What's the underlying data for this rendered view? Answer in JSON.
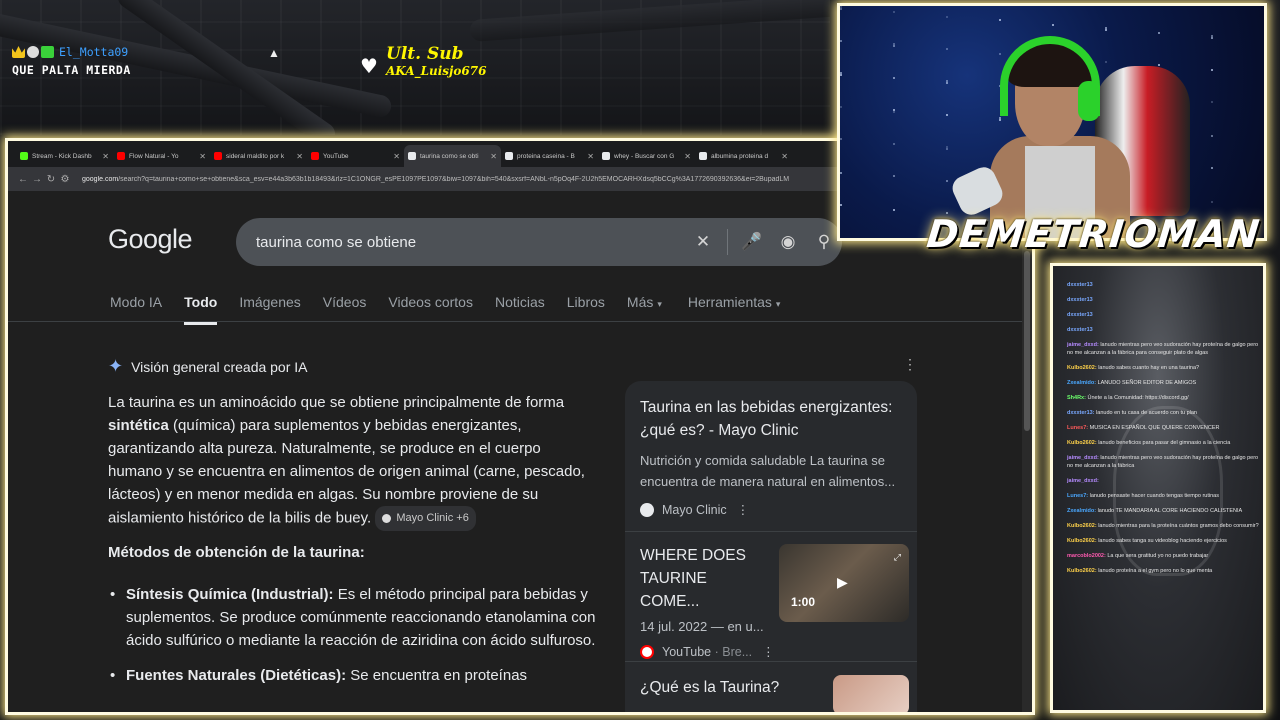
{
  "overlay": {
    "chat_user": "El_Motta09",
    "chat_msg": "QUE PALTA MIERDA",
    "ult_sub_label": "Ult. Sub",
    "ult_sub_name": "AKA_Luisjo676",
    "streamer_name": "DEMETRIOMAN"
  },
  "browser": {
    "tabs": [
      {
        "title": "Stream - Kick Dashb",
        "color": "#53fc18",
        "active": false
      },
      {
        "title": "Flow Natural - Yo",
        "color": "#ff0000",
        "active": false
      },
      {
        "title": "sideral maldito por k",
        "color": "#ff0000",
        "active": false
      },
      {
        "title": "YouTube",
        "color": "#ff0000",
        "active": false
      },
      {
        "title": "taurina como se obti",
        "color": "#e8eaed",
        "active": true
      },
      {
        "title": "proteina caseina - B",
        "color": "#e8eaed",
        "active": false
      },
      {
        "title": "whey - Buscar con G",
        "color": "#e8eaed",
        "active": false
      },
      {
        "title": "albumina proteina d",
        "color": "#e8eaed",
        "active": false
      }
    ],
    "url_host": "google.com",
    "url_rest": "/search?q=taurina+como+se+obtiene&sca_esv=e44a3b63b1b18493&rlz=1C1ONGR_esPE1097PE1097&biw=1097&bih=540&sxsrf=ANbL-n5pOq4F-2U2h5EMOCARHXdsq5bCCg%3A1772690392636&ei=2BupadLM"
  },
  "google": {
    "logo": "Google",
    "query": "taurina como se obtiene",
    "tabs": [
      "Modo IA",
      "Todo",
      "Imágenes",
      "Vídeos",
      "Videos cortos",
      "Noticias",
      "Libros",
      "Más",
      "Herramientas"
    ],
    "active_tab": "Todo"
  },
  "aio": {
    "header": "Visión general creada por IA",
    "p1_a": "La taurina es un aminoácido que se obtiene principalmente de forma ",
    "p1_b": "sintética",
    "p1_c": " (química) para suplementos y bebidas energizantes, garantizando alta pureza. Naturalmente, se produce en el cuerpo humano y se encuentra en alimentos de origen animal (carne, pescado, lácteos) y en menor medida en algas. Su nombre proviene de su aislamiento histórico de la bilis de buey.",
    "chip": "Mayo Clinic +6",
    "heading": "Métodos de obtención de la taurina:",
    "b1_bold": "Síntesis Química (Industrial):",
    "b1_text": " Es el método principal para bebidas y suplementos. Se produce comúnmente reaccionando etanolamina con ácido sulfúrico o mediante la reacción de aziridina con ácido sulfuroso.",
    "b2_bold": "Fuentes Naturales (Dietéticas):",
    "b2_text": " Se encuentra en proteínas"
  },
  "sources": {
    "s1_title": "Taurina en las bebidas energizantes: ¿qué es? - Mayo Clinic",
    "s1_desc": "Nutrición y comida saludable La taurina se encuentra de manera natural en alimentos...",
    "s1_site": "Mayo Clinic",
    "s2_title": "WHERE DOES TAURINE COME...",
    "s2_date": "14 jul. 2022 — en u...",
    "s2_site": "YouTube",
    "s2_channel": "· Bre...",
    "s2_dur": "1:00",
    "s3_title": "¿Qué es la Taurina?"
  },
  "chat": {
    "lines": [
      {
        "u": "dxxxter13",
        "m": "",
        "c": "#79a8ff"
      },
      {
        "u": "dxxxter13",
        "m": "",
        "c": "#79a8ff"
      },
      {
        "u": "dxxxter13",
        "m": "",
        "c": "#79a8ff"
      },
      {
        "u": "dxxxter13",
        "m": "",
        "c": "#79a8ff"
      },
      {
        "u": "jaime_dxxd:",
        "m": "lanudo mientras pero veo sudoración hay proteína de galgo pero no me alcanzan a la fábrica para conseguir plato de algas",
        "c": "#b58bff"
      },
      {
        "u": "Kulbo2602:",
        "m": "lanudo sabes cuanto hay en una taurina?",
        "c": "#ffd24a"
      },
      {
        "u": "Zxealmido:",
        "m": "LANUDO SEÑOR EDITOR DE AMIGOS",
        "c": "#4aa8ff"
      },
      {
        "u": "Sh4Rx:",
        "m": "Únete a la Comunidad: https://discord.gg/",
        "c": "#6bff6b"
      },
      {
        "u": "dxxxter13:",
        "m": "lanudo en tu casa de acuerdo con tu plan",
        "c": "#79a8ff"
      },
      {
        "u": "Lunes7:",
        "m": "MUSICA EN ESPAÑOL QUE QUIERE CONVENCER",
        "c": "#ff5a5a"
      },
      {
        "u": "Kulbo2602:",
        "m": "lanudo beneficios para pasar del gimnasio a la ciencia",
        "c": "#ffd24a"
      },
      {
        "u": "jaime_dxxd:",
        "m": "lanudo mientras pero veo sudoración hay proteína de galgo pero no me alcanzan a la fábrica",
        "c": "#b58bff"
      },
      {
        "u": "jaime_dxxd:",
        "m": "",
        "c": "#b58bff"
      },
      {
        "u": "Lunes7:",
        "m": "lanudo pensaste hacer cuando tengas tiempo rutinas",
        "c": "#4aa8ff"
      },
      {
        "u": "Zxealmido:",
        "m": "lanudo TE MANDARIA AL CORE HACIENDO CALISTENIA",
        "c": "#4aa8ff"
      },
      {
        "u": "Kulbo2602:",
        "m": "lanudo mientras para la proteína cuántos gramos debo consumir?",
        "c": "#ffd24a"
      },
      {
        "u": "Kulbo2602:",
        "m": "lanudo sabes tanga su videoblog haciendo ejercicios",
        "c": "#ffd24a"
      },
      {
        "u": "marcoblo2002:",
        "m": "La que sera gratitud yo no puedo trabajar",
        "c": "#ff5ab0"
      },
      {
        "u": "Kulbo2602:",
        "m": "lanudo proteína a el gym pero no lo que menta",
        "c": "#ffd24a"
      }
    ]
  },
  "colors": {
    "frame_glow": "#ffe98a",
    "google_bg": "#1f1f1f",
    "link_blue": "#8ab4f8"
  }
}
